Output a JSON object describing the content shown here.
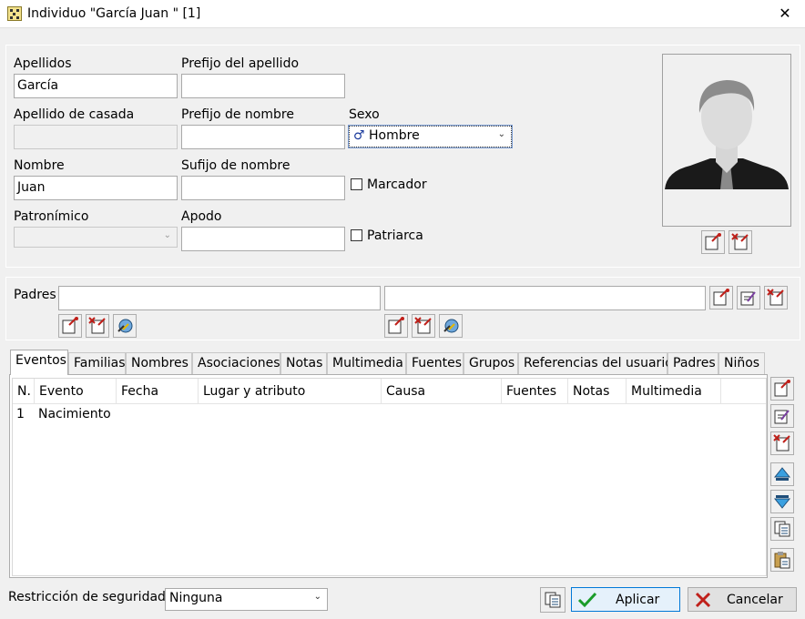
{
  "window": {
    "title": "Individuo \"García Juan \" [1]",
    "close": "✕"
  },
  "form": {
    "apellidos_label": "Apellidos",
    "apellidos_value": "García",
    "prefijo_apellido_label": "Prefijo del apellido",
    "prefijo_apellido_value": "",
    "apellido_casada_label": "Apellido de casada",
    "apellido_casada_value": "",
    "prefijo_nombre_label": "Prefijo de nombre",
    "prefijo_nombre_value": "",
    "sexo_label": "Sexo",
    "sexo_symbol": "♂",
    "sexo_value": "Hombre",
    "nombre_label": "Nombre",
    "nombre_value": "Juan",
    "sufijo_nombre_label": "Sufijo de nombre",
    "sufijo_nombre_value": "",
    "marcador_label": "Marcador",
    "patronimico_label": "Patronímico",
    "patronimico_value": "",
    "apodo_label": "Apodo",
    "apodo_value": "",
    "patriarca_label": "Patriarca"
  },
  "padres": {
    "label": "Padres",
    "father_value": "",
    "mother_value": ""
  },
  "tabs": [
    "Eventos",
    "Familias",
    "Nombres",
    "Asociaciones",
    "Notas",
    "Multimedia",
    "Fuentes",
    "Grupos",
    "Referencias del usuario",
    "Padres",
    "Niños"
  ],
  "events_table": {
    "columns": [
      "N.",
      "Evento",
      "Fecha",
      "Lugar y atributo",
      "Causa",
      "Fuentes",
      "Notas",
      "Multimedia"
    ],
    "rows": [
      {
        "n": "1",
        "evento": "Nacimiento"
      }
    ]
  },
  "footer": {
    "restriction_label": "Restricción de seguridad",
    "restriction_value": "Ninguna",
    "apply_label": "Aplicar",
    "cancel_label": "Cancelar"
  },
  "colors": {
    "accent": "#0078d7",
    "apply_check": "#1a9c2a",
    "cancel_x": "#c0201a"
  }
}
